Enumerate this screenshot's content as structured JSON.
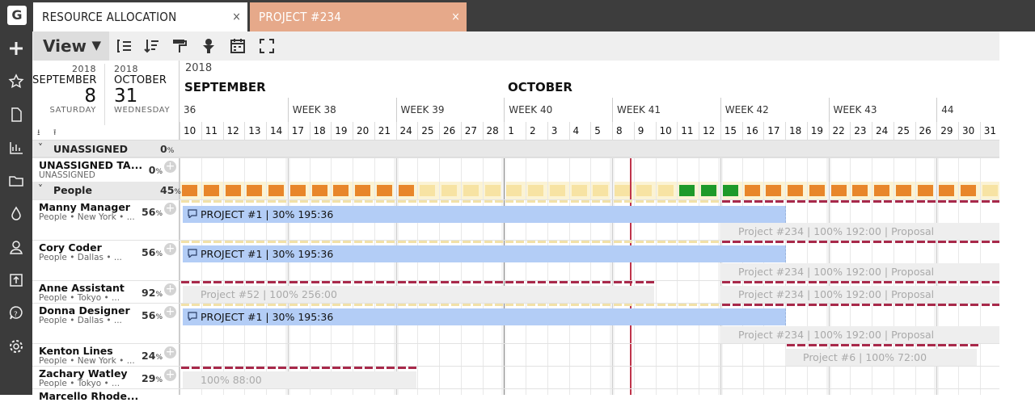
{
  "tabs": [
    {
      "label": "RESOURCE ALLOCATION",
      "close": "×"
    },
    {
      "label": "PROJECT #234",
      "close": "×"
    }
  ],
  "colors": {
    "accent_tab": "#e6a98a",
    "bar_blue": "#b3cdf6",
    "overload_red": "#a8294a",
    "today_line": "#c0344b",
    "heat_orange": "#e8862a",
    "heat_yellow": "#f7e3a3",
    "heat_green": "#1e9a2a"
  },
  "toolbar": {
    "view_label": "View",
    "view_caret": "▼",
    "icons": [
      "indent-icon",
      "sort-icon",
      "paint-roller-icon",
      "filter-icon",
      "calendar-icon",
      "fullscreen-icon"
    ]
  },
  "sidebar": {
    "logo": "G",
    "icons": [
      "plus-icon",
      "star-icon",
      "document-icon",
      "bar-chart-icon",
      "folder-icon",
      "drop-icon",
      "person-icon",
      "export-icon",
      "help-icon",
      "gear-icon"
    ]
  },
  "date_range": {
    "start": {
      "year": "2018",
      "month": "SEPTEMBER",
      "day": "8",
      "weekday": "SATURDAY"
    },
    "end": {
      "year": "2018",
      "month": "OCTOBER",
      "day": "31",
      "weekday": "WEDNESDAY"
    }
  },
  "timeline": {
    "year": "2018",
    "months": [
      "SEPTEMBER",
      "OCTOBER"
    ],
    "weeks": [
      "36",
      "WEEK 38",
      "WEEK 39",
      "WEEK 40",
      "WEEK 41",
      "WEEK 42",
      "WEEK 43",
      "44"
    ],
    "days": [
      "10",
      "11",
      "12",
      "13",
      "14",
      "17",
      "18",
      "19",
      "20",
      "21",
      "24",
      "25",
      "26",
      "27",
      "28",
      "1",
      "2",
      "3",
      "4",
      "5",
      "8",
      "9",
      "10",
      "11",
      "12",
      "15",
      "16",
      "17",
      "18",
      "19",
      "22",
      "23",
      "24",
      "25",
      "26",
      "29",
      "30",
      "31"
    ]
  },
  "groups": {
    "unassigned": {
      "label": "UNASSIGNED",
      "pct": "0",
      "pct_unit": "%",
      "chevron": "˅"
    },
    "people": {
      "label": "People",
      "pct": "45",
      "pct_unit": "%",
      "chevron": "˅"
    }
  },
  "rows": [
    {
      "name": "UNASSIGNED TA...",
      "meta": "UNASSIGNED",
      "pct": "0",
      "pct_unit": "%"
    },
    {
      "name": "Manny Manager",
      "meta": "People • New York • ...",
      "pct": "56",
      "pct_unit": "%"
    },
    {
      "name": "Cory Coder",
      "meta": "People • Dallas • ...",
      "pct": "56",
      "pct_unit": "%"
    },
    {
      "name": "Anne Assistant",
      "meta": "People • Tokyo • ...",
      "pct": "92",
      "pct_unit": "%"
    },
    {
      "name": "Donna Designer",
      "meta": "People • Dallas • ...",
      "pct": "56",
      "pct_unit": "%"
    },
    {
      "name": "Kenton Lines",
      "meta": "People • New York • ...",
      "pct": "24",
      "pct_unit": "%"
    },
    {
      "name": "Zachary Watley",
      "meta": "People • Tokyo • ...",
      "pct": "29",
      "pct_unit": "%"
    },
    {
      "name": "Marcello Rhode...",
      "meta": "",
      "pct": "",
      "pct_unit": ""
    }
  ],
  "bars": {
    "manny_p1": "PROJECT #1 | 30% 195:36",
    "manny_p234": "Project #234 | 100% 192:00 | Proposal",
    "cory_p1": "PROJECT #1 | 30% 195:36",
    "cory_p234": "Project #234 | 100% 192:00 | Proposal",
    "anne_p52": "Project #52 | 100% 256:00",
    "anne_p234": "Project #234 | 100% 192:00 | Proposal",
    "donna_p1": "PROJECT #1 | 30% 195:36",
    "donna_p234": "Project #234 | 100% 192:00 | Proposal",
    "kenton_p6": "Project #6 | 100% 72:00",
    "zachary_p": "100% 88:00"
  },
  "heatmap": {
    "segments": [
      {
        "status": "orange",
        "count": 11
      },
      {
        "status": "yellow",
        "count": 12
      },
      {
        "status": "green",
        "count": 3
      },
      {
        "status": "orange",
        "count": 11
      },
      {
        "status": "yellow",
        "count": 1
      }
    ]
  }
}
